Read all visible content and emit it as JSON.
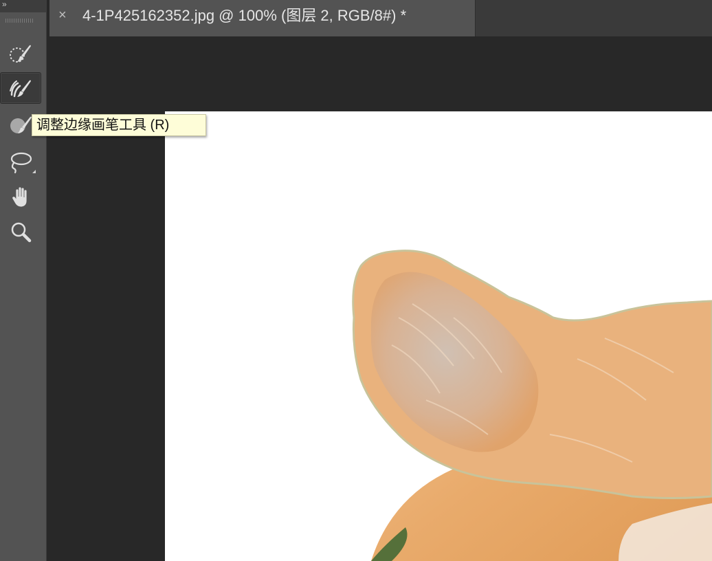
{
  "toolbar": {
    "collapse_glyph": "»",
    "tools": [
      {
        "id": "quick-selection",
        "icon": "quick-selection-brush-icon",
        "active": false
      },
      {
        "id": "refine-edge-brush",
        "icon": "refine-edge-brush-icon",
        "active": true
      },
      {
        "id": "brush",
        "icon": "brush-icon",
        "active": false
      },
      {
        "id": "lasso",
        "icon": "lasso-icon",
        "active": false,
        "has_flyout": true
      },
      {
        "id": "hand",
        "icon": "hand-icon",
        "active": false
      },
      {
        "id": "zoom",
        "icon": "zoom-icon",
        "active": false
      }
    ]
  },
  "tab": {
    "close_glyph": "×",
    "title": "4-1P425162352.jpg @ 100% (图层 2, RGB/8#) *"
  },
  "tooltip": {
    "text": "调整边缘画笔工具 (R)"
  },
  "canvas": {
    "background_color": "#ffffff",
    "subject": "corgi-ear-cutout"
  },
  "colors": {
    "toolbar_bg": "#535353",
    "app_bg": "#282828",
    "tab_active_bg": "#535353",
    "tooltip_bg": "#fefdd8",
    "icon_color": "#e0e0e0"
  }
}
